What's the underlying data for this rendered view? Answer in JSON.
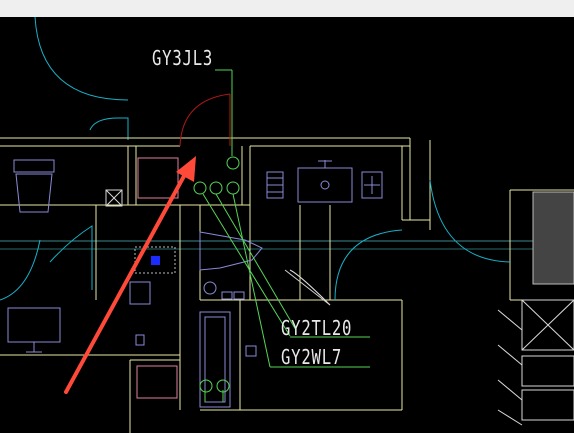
{
  "app": {
    "labels": {
      "riser_1": "GY3JL3",
      "riser_2": "GY2TL20",
      "riser_3": "GY2WL7"
    },
    "colors": {
      "background": "#000000",
      "wall": "#e8e8a0",
      "pipe": "#55d455",
      "door_arc": "#b01818",
      "cyan_arc": "#18b0c8",
      "fixture": "#8a8ad8",
      "annotation_arrow": "#ff4a3a",
      "marker": "#1c2cff",
      "text": "#e9e9e9"
    },
    "icons": [
      "arrow-annotation-icon"
    ]
  }
}
